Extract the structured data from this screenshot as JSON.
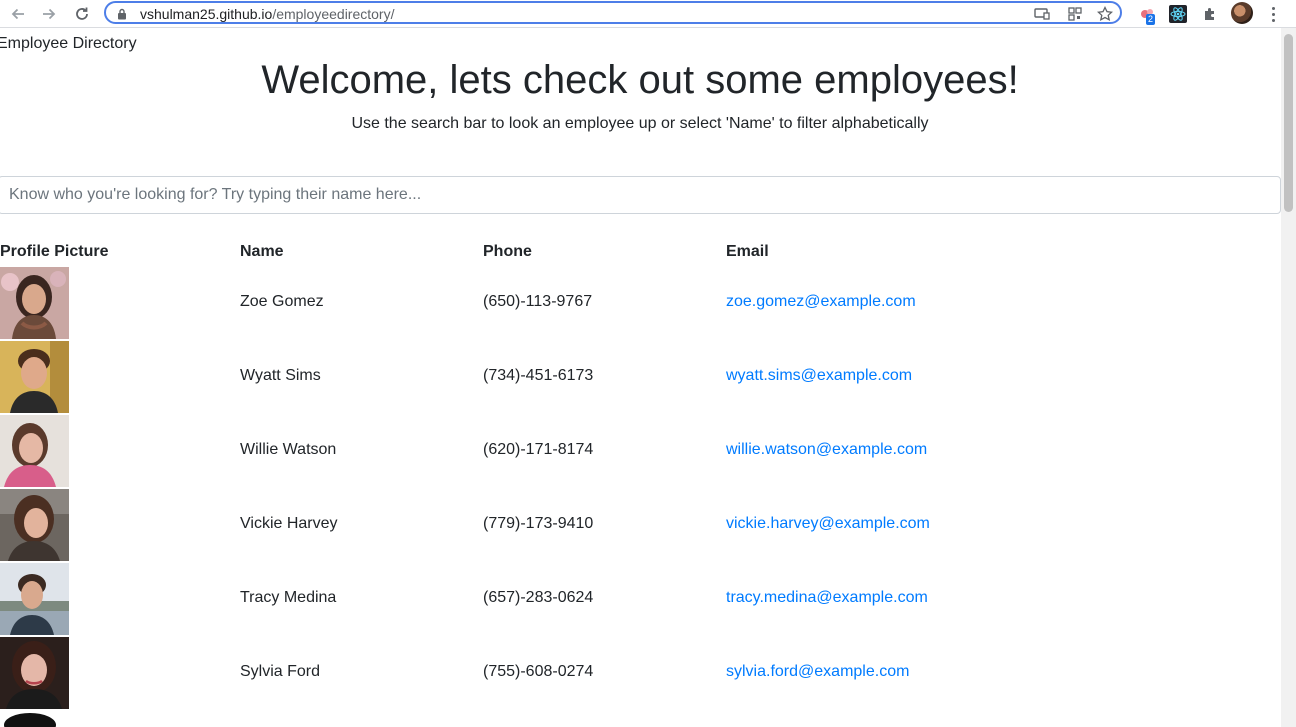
{
  "browser": {
    "url_host": "vshulman25.github.io",
    "url_path": "/employeedirectory/",
    "extension_badge": "2"
  },
  "page": {
    "brand": "Employee Directory",
    "heading": "Welcome, lets check out some employees!",
    "subheading": "Use the search bar to look an employee up or select 'Name' to filter alphabetically",
    "search_placeholder": "Know who you're looking for? Try typing their name here..."
  },
  "table": {
    "headers": [
      "Profile Picture",
      "Name",
      "Phone",
      "Email"
    ],
    "rows": [
      {
        "name": "Zoe Gomez",
        "phone": "(650)-113-9767",
        "email": "zoe.gomez@example.com"
      },
      {
        "name": "Wyatt Sims",
        "phone": "(734)-451-6173",
        "email": "wyatt.sims@example.com"
      },
      {
        "name": "Willie Watson",
        "phone": "(620)-171-8174",
        "email": "willie.watson@example.com"
      },
      {
        "name": "Vickie Harvey",
        "phone": "(779)-173-9410",
        "email": "vickie.harvey@example.com"
      },
      {
        "name": "Tracy Medina",
        "phone": "(657)-283-0624",
        "email": "tracy.medina@example.com"
      },
      {
        "name": "Sylvia Ford",
        "phone": "(755)-608-0274",
        "email": "sylvia.ford@example.com"
      }
    ]
  },
  "colors": {
    "link": "#007bff",
    "text": "#212529",
    "url_focus": "#4d7ee8"
  }
}
